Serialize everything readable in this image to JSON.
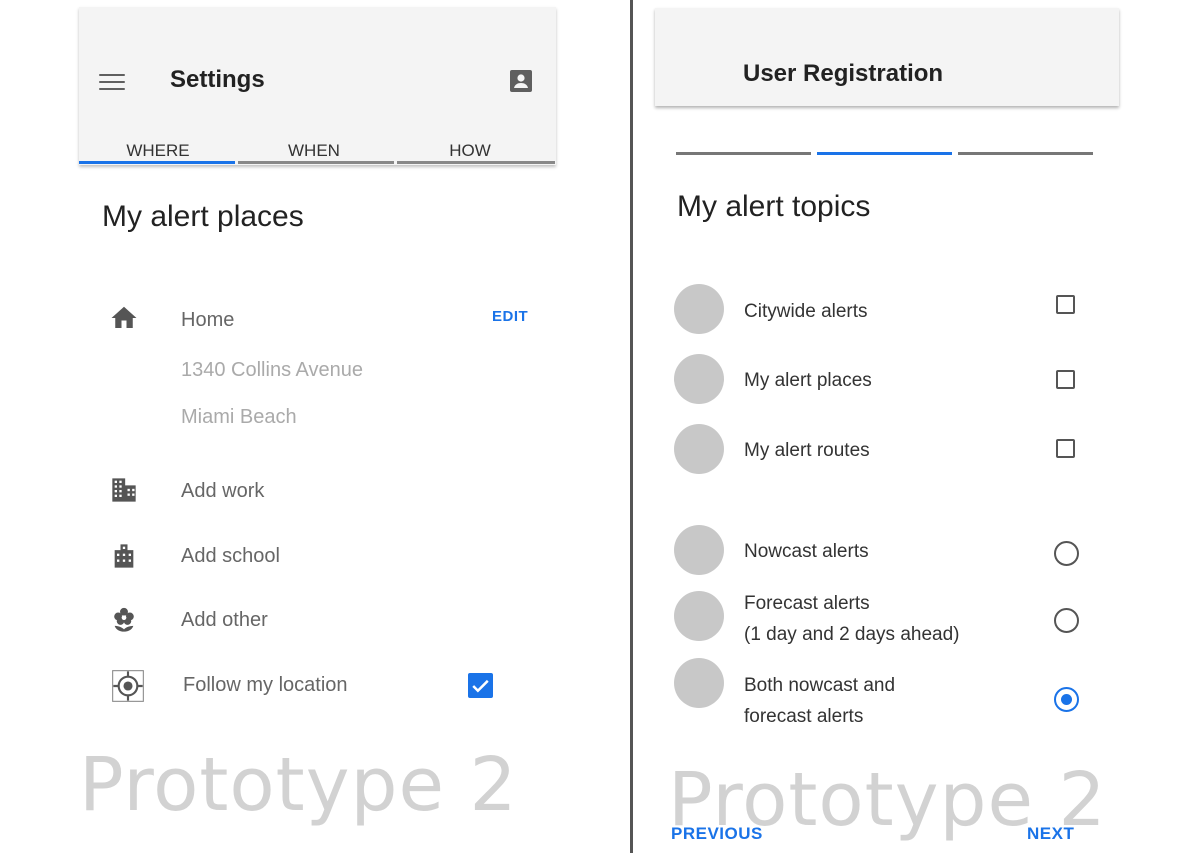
{
  "left": {
    "appbar": {
      "title": "Settings",
      "menu_icon": "menu-icon",
      "account_icon": "account-box-icon"
    },
    "tabs": [
      {
        "label": "WHERE",
        "active": true
      },
      {
        "label": "WHEN",
        "active": false
      },
      {
        "label": "HOW",
        "active": false
      }
    ],
    "section_title": "My alert places",
    "places": {
      "home": {
        "icon": "home-icon",
        "label": "Home",
        "address_line1": "1340 Collins Avenue",
        "address_line2": "Miami Beach",
        "edit": "EDIT"
      },
      "work": {
        "icon": "building-icon",
        "label": "Add work"
      },
      "school": {
        "icon": "school-icon",
        "label": "Add school"
      },
      "other": {
        "icon": "flower-icon",
        "label": "Add other"
      },
      "location": {
        "icon": "location-target-icon",
        "label": "Follow my location",
        "checked": true
      }
    },
    "watermark": "Prototype 2"
  },
  "right": {
    "appbar": {
      "title": "User Registration"
    },
    "steps": [
      {
        "active": false
      },
      {
        "active": true
      },
      {
        "active": false
      }
    ],
    "section_title": "My alert topics",
    "topics": [
      {
        "label": "Citywide alerts",
        "control": "checkbox",
        "checked": false
      },
      {
        "label": "My alert places",
        "control": "checkbox",
        "checked": false
      },
      {
        "label": "My alert routes",
        "control": "checkbox",
        "checked": false
      },
      {
        "label": "Nowcast alerts",
        "control": "radio",
        "checked": false
      },
      {
        "label": "Forecast alerts",
        "label2": "(1 day and 2 days ahead)",
        "control": "radio",
        "checked": false
      },
      {
        "label": "Both nowcast and",
        "label2": "forecast alerts",
        "control": "radio",
        "checked": true
      }
    ],
    "watermark": "Prototype 2",
    "nav": {
      "previous": "PREVIOUS",
      "next": "NEXT"
    }
  },
  "colors": {
    "accent": "#1a73e8",
    "avatar": "#c8c8c8",
    "appbar": "#f4f4f4",
    "watermark": "#d2d2d2"
  }
}
